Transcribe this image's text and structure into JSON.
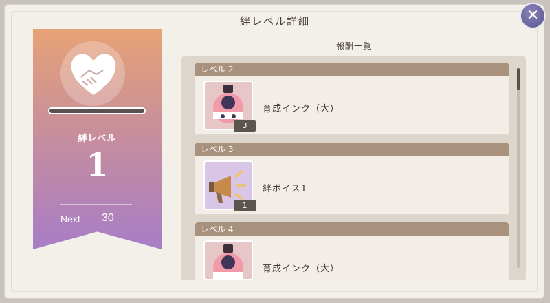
{
  "header": {
    "title": "絆レベル詳細",
    "close_icon": "close-icon"
  },
  "kizuna": {
    "label": "絆レベル",
    "level": "1",
    "next_label": "Next",
    "next_value": "30",
    "progress": 0
  },
  "rewards": {
    "title": "報酬一覧",
    "levels": [
      {
        "label": "レベル 2",
        "item": "育成インク（大）",
        "qty": "3",
        "icon": "ink-bottle-icon"
      },
      {
        "label": "レベル 3",
        "item": "絆ボイス1",
        "qty": "1",
        "icon": "megaphone-icon"
      },
      {
        "label": "レベル 4",
        "item": "育成インク（大）",
        "qty": "",
        "icon": "ink-bottle-icon"
      }
    ]
  },
  "colors": {
    "banner_top": "#e6a276",
    "banner_bottom": "#a77dc7",
    "header_bar": "#a8917d"
  }
}
